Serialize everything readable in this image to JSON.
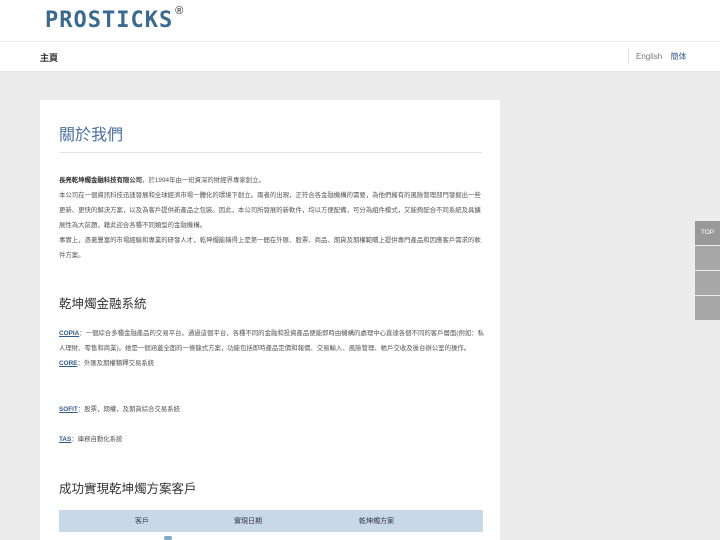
{
  "header": {
    "logo_text": "PROSTICKS",
    "logo_reg": "®",
    "nav_home": "主頁",
    "lang_en": "English",
    "lang_zh": "簡体"
  },
  "main": {
    "title": "關於我們",
    "intro_company": "長亮乾坤燭金融科技有限公司",
    "intro_line1": "，於1994年由一班資深的財經界專家創立。",
    "intro_line2": "本公司在一個資訊科技迅速發展和全球經濟市場一體化的環境下創立。兩者的出現，正符合各金融機構的需要，為他們擁有的風險管理部門發掘出一些更新、更快的解決方案，以及為客戶提供新產品之包裝。因此，本公司所發展的新軟件，均以方便配備，可分為組件模式，又能夠配合不同系統及具擴展性為大前題，藉此迎合各種不同類型的金融機構。",
    "intro_line3": "事實上，憑著豐富的市場經驗和專業的研發人才，乾坤燭能稱得上是第一間在外匯、股票、商品、期貨及期權範疇上提供專門產品和因應客戶需求的軟件方案。",
    "systems_heading": "乾坤燭金融系統",
    "systems": [
      {
        "name": "COPIA",
        "desc": "：一個綜合多種金融產品的交易平台。通過這個平台，各種不同的金融和投資產品便能即時由機構的處理中心直達各個不同的客戶層面(例如：私人理財、零售和商業)。她是一個涵蓋全面的一條龍式方案，功能包括即時產品定價和報價、交易輸入、風險管理、帳戶交收及後台辦公室的操作。"
      },
      {
        "name": "CORE",
        "desc": "：外匯及期權積釋交易系統"
      },
      {
        "name": "SOFIT",
        "desc": "：股票，期權，及期貨綜合交易系統"
      },
      {
        "name": "TAS",
        "desc": "：庫務自動化系統"
      }
    ],
    "clients_heading": "成功實現乾坤燭方案客戶",
    "table_headers": [
      "客戶",
      "實現日期",
      "乾坤燭方案"
    ]
  },
  "side_tools": {
    "top_label": "TOP"
  }
}
